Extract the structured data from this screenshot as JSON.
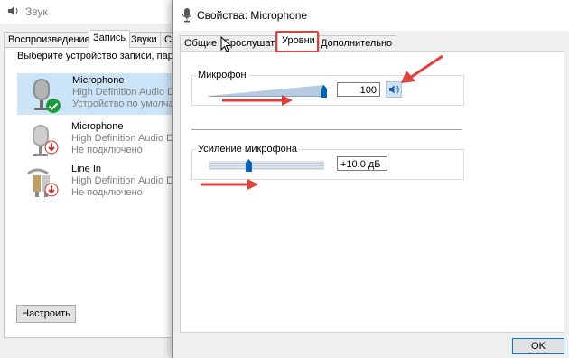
{
  "sound_window": {
    "title": "Звук",
    "tabs": [
      {
        "label": "Воспроизведение",
        "active": false
      },
      {
        "label": "Запись",
        "active": true
      },
      {
        "label": "Звуки",
        "active": false
      },
      {
        "label": "Св",
        "active": false
      }
    ],
    "instruction": "Выберите устройство записи, парам",
    "devices": [
      {
        "name": "Microphone",
        "description": "High Definition Audio De",
        "status": "Устройство по умолча",
        "selected": true,
        "icon": "microphone-icon",
        "badge": "check-badge-icon"
      },
      {
        "name": "Microphone",
        "description": "High Definition Audio De",
        "status": "Не подключено",
        "selected": false,
        "icon": "microphone-icon",
        "badge": "down-arrow-badge-icon"
      },
      {
        "name": "Line In",
        "description": "High Definition Audio De",
        "status": "Не подключено",
        "selected": false,
        "icon": "line-in-plug-icon",
        "badge": "down-arrow-badge-icon"
      }
    ],
    "configure_button": "Настроить"
  },
  "properties_dialog": {
    "title": "Свойства: Microphone",
    "tabs": [
      {
        "label": "Общие",
        "active": false
      },
      {
        "label": "Прослушать",
        "active": false
      },
      {
        "label": "Уровни",
        "active": true
      },
      {
        "label": "Дополнительно",
        "active": false
      }
    ],
    "microphone_group": {
      "label": "Микрофон",
      "level": 100,
      "level_fraction": 1.0,
      "value": "100",
      "speaker_icon": "speaker-icon"
    },
    "boost_group": {
      "label": "Усиление микрофона",
      "value": "+10.0 дБ",
      "level_fraction": 0.33
    },
    "ok_button": "OK"
  },
  "colors": {
    "annotation_red": "#e0403a",
    "selection_blue": "#cce4f7",
    "slider_thumb": "#0063b1"
  }
}
